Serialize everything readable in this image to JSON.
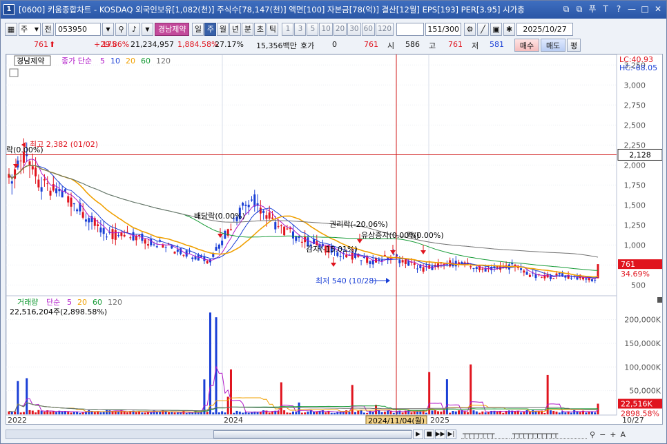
{
  "title": {
    "window_num": "1",
    "text": "[0600] 키움종합차트 - KOSDAQ 외국인보유[1,082(천)] 주식수[78,147(천)] 액면[100] 자본금[78(억)] 결산[12월] EPS[193] PER[3.95] 시가총",
    "btn_icons": [
      "restore-icon",
      "copy-icon",
      "pin-icon",
      "text-icon",
      "help-icon",
      "minimize-icon",
      "maximize-icon",
      "close-icon"
    ],
    "btn_glyphs": [
      "⧉",
      "⧉",
      "푸",
      "T",
      "?",
      "—",
      "□",
      "✕"
    ]
  },
  "toolbar": {
    "mode_label": "주",
    "prev_label": "전",
    "code": "053950",
    "stock_name": "경남제약",
    "periods": [
      "일",
      "주",
      "월",
      "년",
      "분",
      "초",
      "틱"
    ],
    "selected_period": "주",
    "intervals": [
      "1",
      "3",
      "5",
      "10",
      "20",
      "30",
      "60",
      "120"
    ],
    "count_value": "151",
    "count_total": "/300",
    "date": "2025/10/27"
  },
  "quote": {
    "price": "761",
    "change": "175",
    "change_pct": "+29.86%",
    "volume": "21,234,957",
    "volume_pct": "1,884.58%",
    "turnover": "27.17%",
    "amount": "15,356백만",
    "hoga_label": "호가",
    "hoga_value": "0",
    "hoga_price": "761",
    "open_label": "시",
    "open": "586",
    "high_label": "고",
    "high": "761",
    "low_label": "저",
    "low": "581",
    "buy_label": "매수",
    "sell_label": "매도",
    "avg_label": "평"
  },
  "colors": {
    "up": "#e0141e",
    "down": "#1a3fd6",
    "ma5": "#b018c8",
    "ma10": "#1a3fd6",
    "ma20": "#f0a000",
    "ma60": "#159a35",
    "ma120": "#707070"
  },
  "legend_price": {
    "name": "경남제약",
    "series_label": "종가 단순",
    "ma": [
      "5",
      "10",
      "20",
      "60",
      "120"
    ]
  },
  "legend_volume": {
    "name": "거래량",
    "series_label": "단순",
    "ma": [
      "5",
      "20",
      "60",
      "120"
    ],
    "value": "22,516,204주(2,898.58%)"
  },
  "chart_data": {
    "type": "candlestick",
    "price_axis": {
      "ticks": [
        500,
        750,
        1000,
        1250,
        1500,
        1750,
        2000,
        2250,
        2500,
        2750,
        3000,
        3250
      ],
      "tick_labels": [
        "500",
        "750",
        "1,000",
        "1,250",
        "1,500",
        "1,750",
        "2,000",
        "2,250",
        "2,500",
        "2,750",
        "3,000",
        "3,250"
      ],
      "range": [
        400,
        3330
      ]
    },
    "volume_axis": {
      "ticks": [
        50000,
        100000,
        150000,
        200000
      ],
      "tick_labels": [
        "50,000K",
        "100,000K",
        "150,000K",
        "200,000K"
      ],
      "range": [
        0,
        230000
      ]
    },
    "x_labels": [
      "2022",
      "2024",
      "2025"
    ],
    "last_date_label": "10/27",
    "top_labels": [
      "LC:40.93",
      "HC:-68.05"
    ],
    "current_price": "761",
    "current_pct": "34.69%",
    "crosshair_price": "2,128",
    "crosshair_date": "2024/11/04(월)",
    "current_volume": "22,516K",
    "current_volume_pct": "2898.58%",
    "annotations": {
      "high": "최고 2,382 (01/02)",
      "low": "최저 540 (10/28)",
      "rak1": "락(0.00%)",
      "baedang": "배당락(0.00%)",
      "gwonri": "권리락(-20.06%)",
      "gamja": "감자(-15.01%)",
      "yusang": "유상증자(0.00%)",
      "rak2": "락(0.00%)"
    }
  }
}
